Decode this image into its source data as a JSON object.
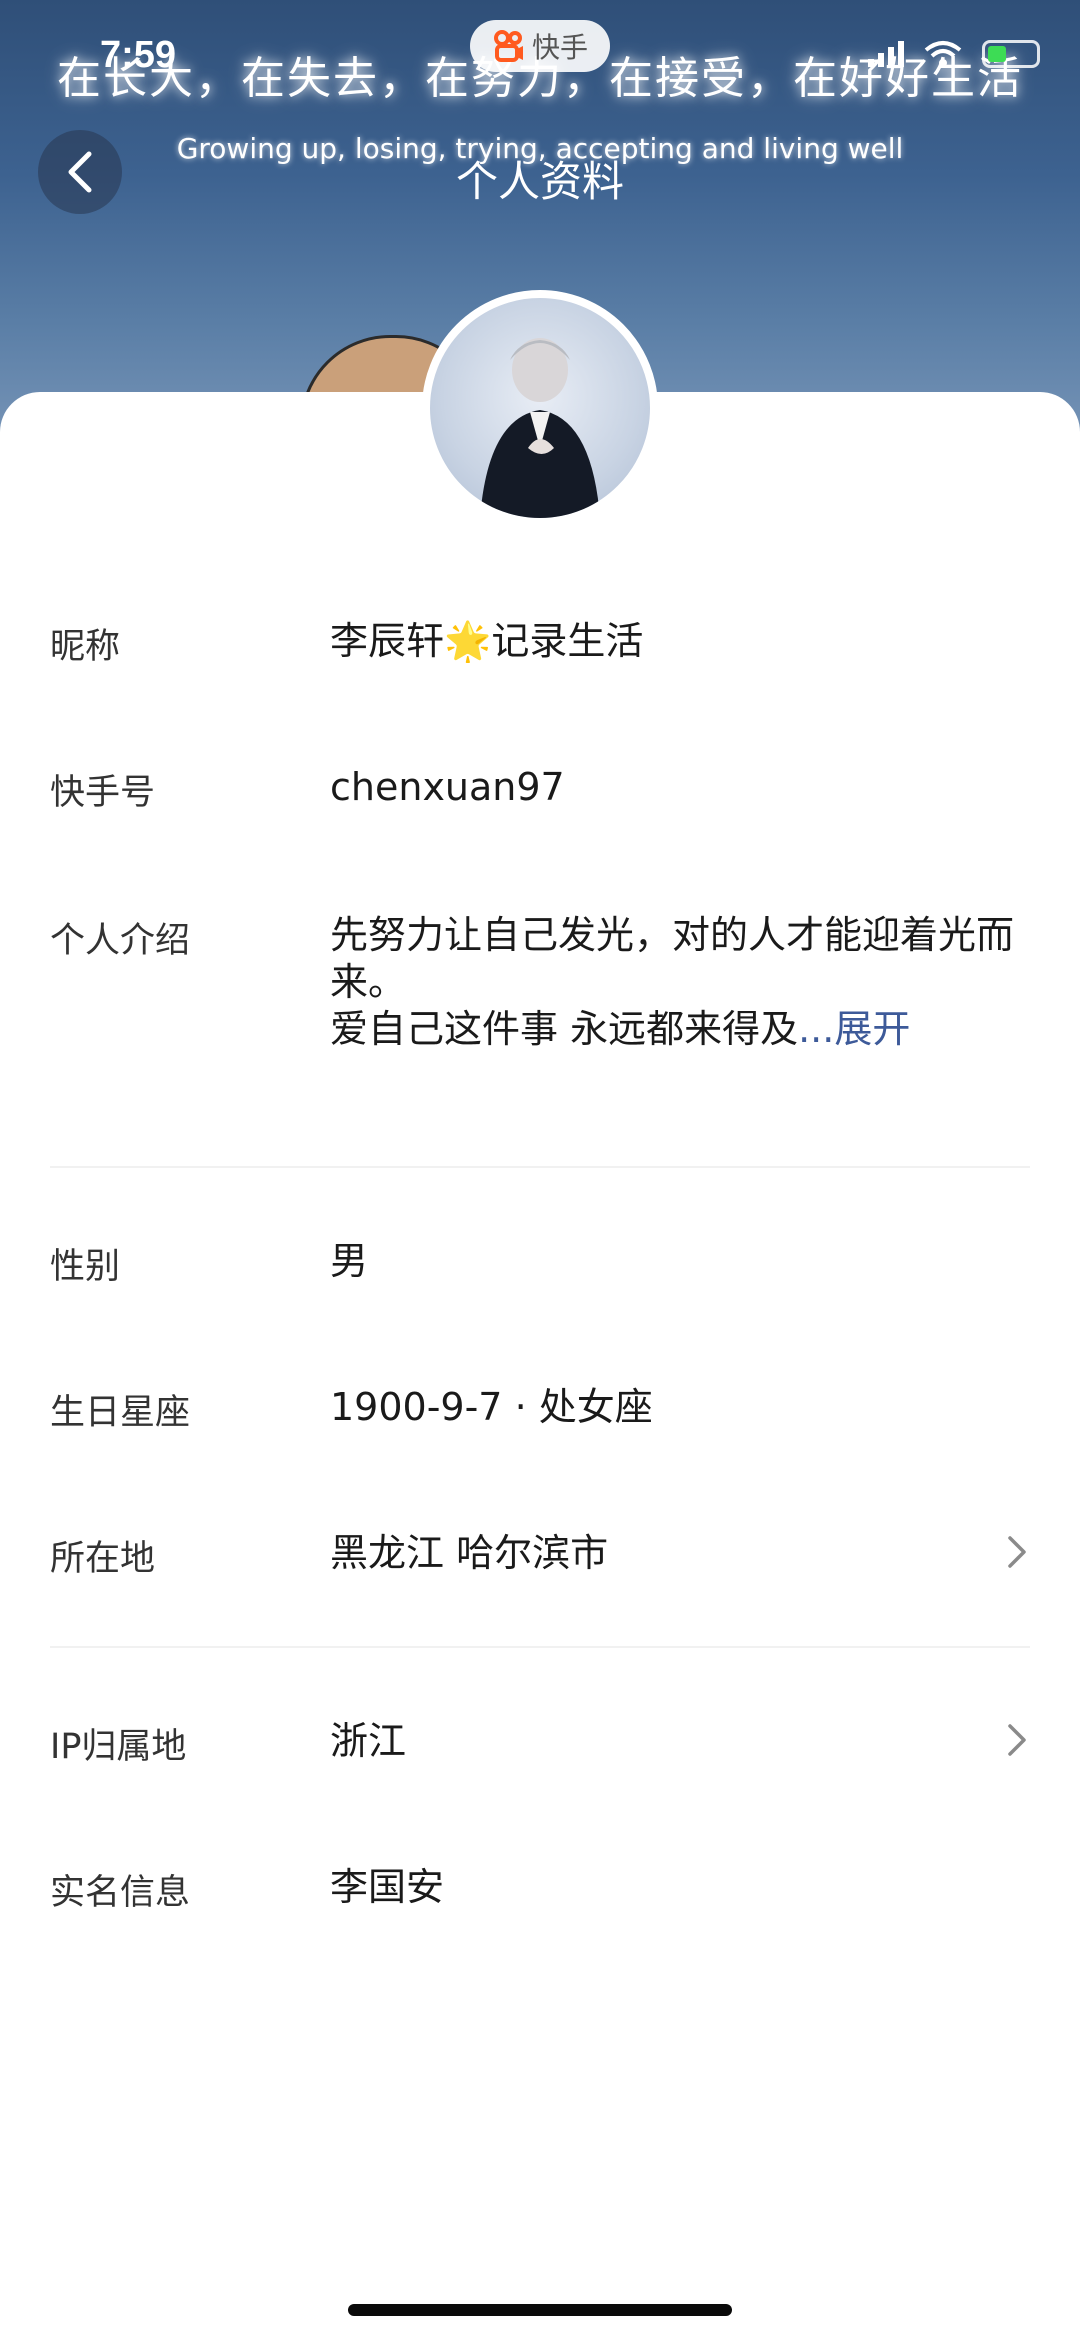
{
  "status_bar": {
    "time": "7:59",
    "app_badge": "快手"
  },
  "header": {
    "banner_text_cn": "在长大，在失去，在努力，在接受，在好好生活",
    "banner_text_en": "Growing up, losing, trying, accepting and living well",
    "title": "个人资料"
  },
  "profile": {
    "rows": [
      {
        "label": "昵称",
        "value": "李辰轩🌟记录生活"
      },
      {
        "label": "快手号",
        "value": "chenxuan97"
      },
      {
        "label": "个人介绍",
        "value_line1": "先努力让自己发光，对的人才能迎着光而来。",
        "value_line2": "爱自己这件事 永远都来得及",
        "more": "...展开"
      },
      {
        "label": "性别",
        "value": "男"
      },
      {
        "label": "生日星座",
        "value": "1900-9-7 · 处女座"
      },
      {
        "label": "所在地",
        "value": "黑龙江 哈尔滨市"
      },
      {
        "label": "IP归属地",
        "value": "浙江"
      },
      {
        "label": "实名信息",
        "value": "李国安"
      }
    ]
  },
  "icons": {
    "back": "chevron-left-icon",
    "location_arrow": "chevron-right-icon",
    "ip_arrow": "chevron-right-icon"
  },
  "colors": {
    "banner": "#3d6290",
    "more_link": "#3d5a99",
    "label_text": "#333333",
    "value_text": "#1a1a1a"
  }
}
